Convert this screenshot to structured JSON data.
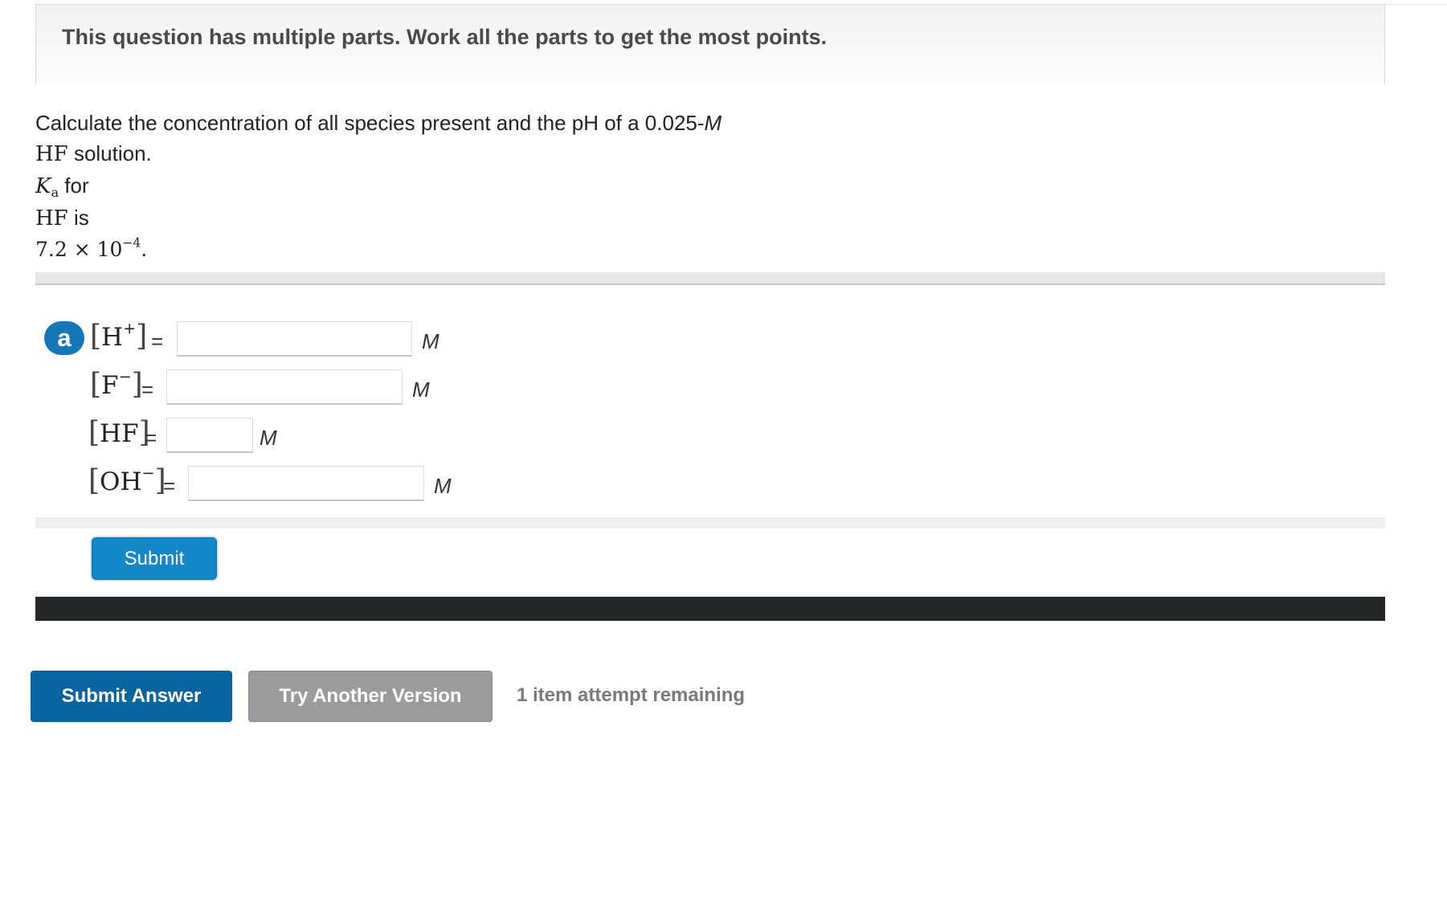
{
  "notice": "This question has multiple parts. Work all the parts to get the most points.",
  "question": {
    "line1": "Calculate the concentration of all species present and the pH of a 0.025-",
    "line1_unit": "M",
    "line2_species": "HF",
    "line2_text": " solution.",
    "ka_symbol": "K",
    "ka_sub": "a",
    "line3_text": " for",
    "line4_species": "HF",
    "line4_text": " is",
    "ka_value": "7.2 × 10",
    "ka_exp": "−4",
    "ka_period": "."
  },
  "part_a": {
    "badge": "a",
    "equals": "=",
    "rows": [
      {
        "species": "H",
        "charge": "+",
        "value": "",
        "unit": "M"
      },
      {
        "species": "F",
        "charge": "−",
        "value": "",
        "unit": "M"
      },
      {
        "species": "HF",
        "charge": "",
        "value": "",
        "unit": "M"
      },
      {
        "species": "OH",
        "charge": "−",
        "value": "",
        "unit": "M"
      }
    ]
  },
  "submit_label": "Submit",
  "footer": {
    "submit_answer": "Submit Answer",
    "try_another": "Try Another Version",
    "attempts": "1 item attempt remaining"
  },
  "colors": {
    "badge": "#1478b8",
    "submit": "#1488c8",
    "submit_answer": "#0a64a0",
    "try_another": "#9b9b9b",
    "dark_bar": "#252628"
  }
}
